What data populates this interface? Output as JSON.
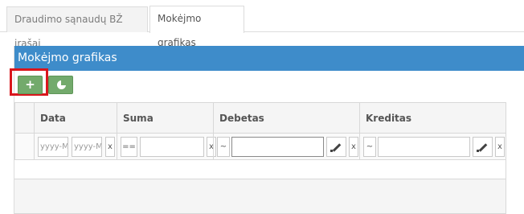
{
  "tabs": [
    {
      "label": "Draudimo sąnaudų BŽ įrašai",
      "active": false
    },
    {
      "label": "Mokėjmo grafikas",
      "active": true
    }
  ],
  "panel": {
    "title": "Mokėjmo grafikas",
    "header_color": "#3e8cca"
  },
  "toolbar": {
    "add_label": "+",
    "add_icon": "plus-icon",
    "chart_icon": "pie-chart-icon",
    "button_color": "#73aa6c",
    "highlight_color": "#d9161c"
  },
  "grid": {
    "columns": [
      "Data",
      "Suma",
      "Debetas",
      "Kreditas"
    ],
    "filters": {
      "date_from_placeholder": "yyyy-MM-dd",
      "date_to_placeholder": "yyyy-MM-dd",
      "clear": "x",
      "sum_operator": "==",
      "debit_operator": "~",
      "credit_operator": "~"
    }
  }
}
